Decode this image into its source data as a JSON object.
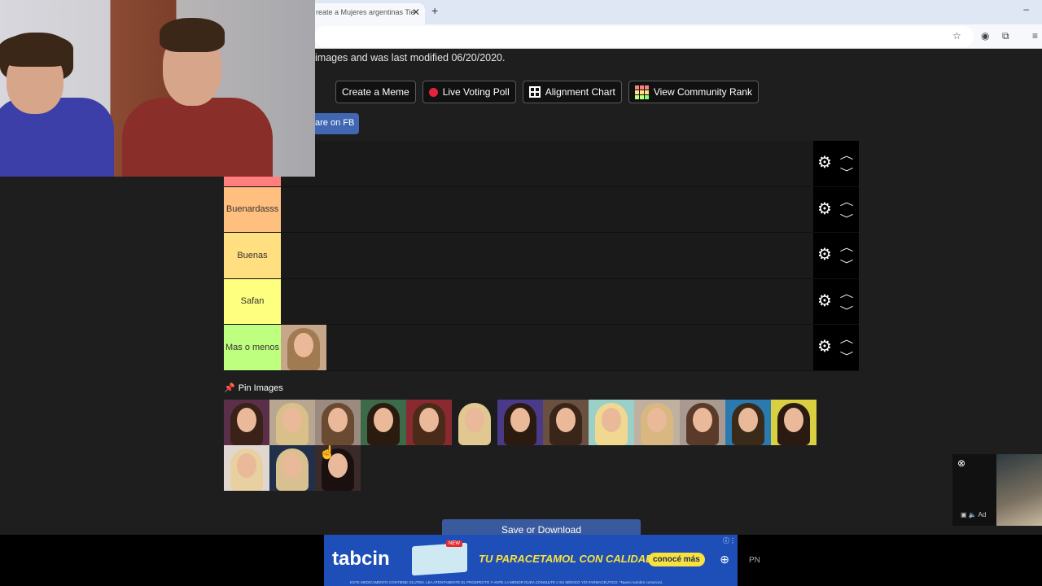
{
  "browser": {
    "tab_title": "reate a Mujeres argentinas Tie",
    "tab_close": "✕",
    "new_tab": "+",
    "minimize": "–",
    "toolbar_icons": [
      "star-icon",
      "extension-icon",
      "puzzle-icon",
      "menu-icon"
    ]
  },
  "page": {
    "modified_text": "images and was last modified 06/20/2020.",
    "buttons": {
      "create_meme": "Create a Meme",
      "live_poll": "Live Voting Poll",
      "alignment_chart": "Alignment Chart",
      "community_rank": "View Community Rank"
    },
    "share_fb": "are on FB",
    "pin_images": "Pin Images",
    "save_download": "Save or Download"
  },
  "tiers": [
    {
      "label": "",
      "color": "#ff7f7f",
      "items": 0
    },
    {
      "label": "Buenardasss",
      "color": "#ffbf7f",
      "items": 0
    },
    {
      "label": "Buenas",
      "color": "#ffdf7f",
      "items": 0
    },
    {
      "label": "Safan",
      "color": "#ffff7f",
      "items": 0
    },
    {
      "label": "Mas o menos",
      "color": "#bfff7f",
      "items": 1
    }
  ],
  "pool_count": 16,
  "colors": {
    "background": "#1e1e1f",
    "tier_row": "#1a1a1a",
    "fb_blue": "#4267b2",
    "save_blue": "#3a5a9e",
    "poll_red": "#e3243b"
  },
  "ads": {
    "banner_brand": "tabcin",
    "banner_slogan": "TU PARACETAMOL CON CALIDAD BAYER",
    "banner_cta": "conocé más",
    "banner_fine": "ESTE MEDICAMENTO CONTIENE GLUTEN. LEA ATENTAMENTE EL PROSPECTO Y ANTE LA MENOR DUDA CONSULTE A SU MÉDICO Y/O FARMACÉUTICO. *Nuevo nombre comercial.",
    "banner_pack_badge": "NEW",
    "video_ad_label": "Ad",
    "pn_label": "PN"
  }
}
